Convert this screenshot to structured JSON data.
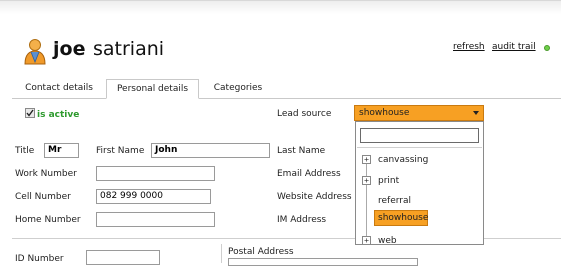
{
  "header": {
    "first_name": "joe",
    "last_name": "satriani",
    "refresh_label": "refresh",
    "audit_trail_label": "audit trail"
  },
  "tabs": [
    {
      "label": "Contact details",
      "active": false
    },
    {
      "label": "Personal details",
      "active": true
    },
    {
      "label": "Categories",
      "active": false
    }
  ],
  "form": {
    "is_active_label": "is active",
    "is_active_checked": true,
    "title_label": "Title",
    "title_value": "Mr",
    "first_name_label": "First Name",
    "first_name_value": "John",
    "last_name_label": "Last Name",
    "work_number_label": "Work Number",
    "work_number_value": "",
    "cell_number_label": "Cell Number",
    "cell_number_value": "082 999 0000",
    "home_number_label": "Home Number",
    "home_number_value": "",
    "email_label": "Email Address",
    "website_label": "Website Address",
    "im_label": "IM Address",
    "id_number_label": "ID Number",
    "id_number_value": "",
    "postal_address_label": "Postal Address",
    "lead_source_label": "Lead source",
    "lead_source_value": "showhouse"
  },
  "lead_source_dropdown": {
    "search_value": "",
    "items": [
      {
        "label": "canvassing",
        "expandable": true,
        "selected": false
      },
      {
        "label": "print",
        "expandable": true,
        "selected": false
      },
      {
        "label": "referral",
        "expandable": false,
        "selected": false
      },
      {
        "label": "showhouse",
        "expandable": false,
        "selected": true
      },
      {
        "label": "web",
        "expandable": true,
        "selected": false
      }
    ]
  },
  "colors": {
    "accent_orange": "#f7a023",
    "active_green": "#2e9a2e",
    "status_dot": "#6fcf4a"
  },
  "icons": {
    "contact": "person-icon",
    "status": "status-dot-icon",
    "dropdown": "chevron-down-icon",
    "expand": "plus-box-icon"
  }
}
